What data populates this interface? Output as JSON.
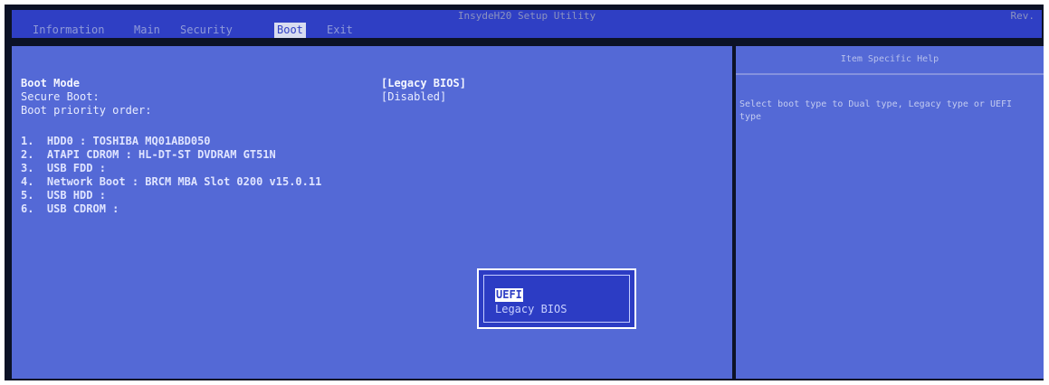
{
  "titlebar": {
    "title": "InsydeH20 Setup Utility",
    "rev": "Rev."
  },
  "tabs": [
    {
      "label": "Information"
    },
    {
      "label": "Main"
    },
    {
      "label": "Security"
    },
    {
      "label": "Boot"
    },
    {
      "label": "Exit"
    }
  ],
  "settings": {
    "boot_mode_label": "Boot Mode",
    "boot_mode_value": "[Legacy BIOS]",
    "secure_boot_label": "Secure Boot:",
    "secure_boot_value": "[Disabled]",
    "boot_priority_label": "Boot priority order:"
  },
  "boot_order": [
    {
      "label": "1.  HDD0 : TOSHIBA MQ01ABD050"
    },
    {
      "label": "2.  ATAPI CDROM : HL-DT-ST DVDRAM GT51N"
    },
    {
      "label": "3.  USB FDD :"
    },
    {
      "label": "4.  Network Boot : BRCM MBA Slot 0200 v15.0.11"
    },
    {
      "label": "5.  USB HDD :"
    },
    {
      "label": "6.  USB CDROM :"
    }
  ],
  "help": {
    "header": "Item Specific Help",
    "text": "Select boot type to Dual type, Legacy type or UEFI type"
  },
  "popup": {
    "options": [
      {
        "label": "UEFI"
      },
      {
        "label": "Legacy BIOS"
      }
    ]
  },
  "colors": {
    "panel": "#5469d6",
    "bar": "#2f3fc4",
    "popup": "#2c3cc4"
  }
}
